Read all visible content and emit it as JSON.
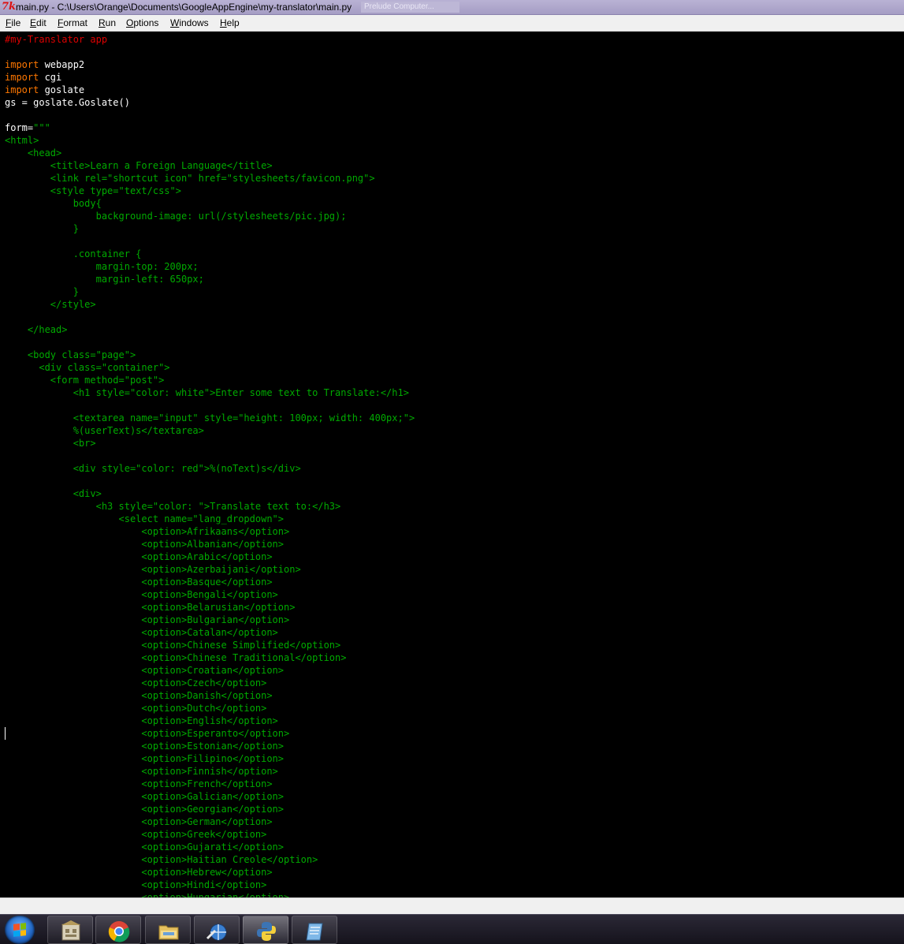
{
  "window": {
    "title": "main.py - C:\\Users\\Orange\\Documents\\GoogleAppEngine\\my-translator\\main.py",
    "background_window_title": "Prelude Computer...",
    "icon": "idle-icon"
  },
  "menu": [
    "File",
    "Edit",
    "Format",
    "Run",
    "Options",
    "Windows",
    "Help"
  ],
  "code_lines": [
    [
      {
        "t": "#my-Translator app",
        "c": "comment"
      }
    ],
    [],
    [
      {
        "t": "import",
        "c": "kw"
      },
      {
        "t": " webapp2",
        "c": "plain"
      }
    ],
    [
      {
        "t": "import",
        "c": "kw"
      },
      {
        "t": " cgi",
        "c": "plain"
      }
    ],
    [
      {
        "t": "import",
        "c": "kw"
      },
      {
        "t": " goslate",
        "c": "plain"
      }
    ],
    [
      {
        "t": "gs = goslate.Goslate()",
        "c": "plain"
      }
    ],
    [],
    [
      {
        "t": "form=",
        "c": "plain"
      },
      {
        "t": "\"\"\"",
        "c": "str"
      }
    ],
    [
      {
        "t": "<html>",
        "c": "str"
      }
    ],
    [
      {
        "t": "    <head>",
        "c": "str"
      }
    ],
    [
      {
        "t": "        <title>Learn a Foreign Language</title>",
        "c": "str"
      }
    ],
    [
      {
        "t": "        <link rel=\"shortcut icon\" href=\"stylesheets/favicon.png\">",
        "c": "str"
      }
    ],
    [
      {
        "t": "        <style type=\"text/css\">",
        "c": "str"
      }
    ],
    [
      {
        "t": "            body{",
        "c": "str"
      }
    ],
    [
      {
        "t": "                background-image: url(/stylesheets/pic.jpg);",
        "c": "str"
      }
    ],
    [
      {
        "t": "            }",
        "c": "str"
      }
    ],
    [],
    [
      {
        "t": "            .container {",
        "c": "str"
      }
    ],
    [
      {
        "t": "                margin-top: 200px;",
        "c": "str"
      }
    ],
    [
      {
        "t": "                margin-left: 650px;",
        "c": "str"
      }
    ],
    [
      {
        "t": "            }",
        "c": "str"
      }
    ],
    [
      {
        "t": "        </style>",
        "c": "str"
      }
    ],
    [],
    [
      {
        "t": "    </head>",
        "c": "str"
      }
    ],
    [],
    [
      {
        "t": "    <body class=\"page\">",
        "c": "str"
      }
    ],
    [
      {
        "t": "      <div class=\"container\">",
        "c": "str"
      }
    ],
    [
      {
        "t": "        <form method=\"post\">",
        "c": "str"
      }
    ],
    [
      {
        "t": "            <h1 style=\"color: white\">Enter some text to Translate:</h1>",
        "c": "str"
      }
    ],
    [],
    [
      {
        "t": "            <textarea name=\"input\" style=\"height: 100px; width: 400px;\">",
        "c": "str"
      }
    ],
    [
      {
        "t": "            %(userText)s</textarea>",
        "c": "str"
      }
    ],
    [
      {
        "t": "            <br>",
        "c": "str"
      }
    ],
    [],
    [
      {
        "t": "            <div style=\"color: red\">%(noText)s</div>",
        "c": "str"
      }
    ],
    [],
    [
      {
        "t": "            <div>",
        "c": "str"
      }
    ],
    [
      {
        "t": "                <h3 style=\"color: \">Translate text to:</h3>",
        "c": "str"
      }
    ],
    [
      {
        "t": "                    <select name=\"lang_dropdown\">",
        "c": "str"
      }
    ],
    [
      {
        "t": "                        <option>Afrikaans</option>",
        "c": "str"
      }
    ],
    [
      {
        "t": "                        <option>Albanian</option>",
        "c": "str"
      }
    ],
    [
      {
        "t": "                        <option>Arabic</option>",
        "c": "str"
      }
    ],
    [
      {
        "t": "                        <option>Azerbaijani</option>",
        "c": "str"
      }
    ],
    [
      {
        "t": "                        <option>Basque</option>",
        "c": "str"
      }
    ],
    [
      {
        "t": "                        <option>Bengali</option>",
        "c": "str"
      }
    ],
    [
      {
        "t": "                        <option>Belarusian</option>",
        "c": "str"
      }
    ],
    [
      {
        "t": "                        <option>Bulgarian</option>",
        "c": "str"
      }
    ],
    [
      {
        "t": "                        <option>Catalan</option>",
        "c": "str"
      }
    ],
    [
      {
        "t": "                        <option>Chinese Simplified</option>",
        "c": "str"
      }
    ],
    [
      {
        "t": "                        <option>Chinese Traditional</option>",
        "c": "str"
      }
    ],
    [
      {
        "t": "                        <option>Croatian</option>",
        "c": "str"
      }
    ],
    [
      {
        "t": "                        <option>Czech</option>",
        "c": "str"
      }
    ],
    [
      {
        "t": "                        <option>Danish</option>",
        "c": "str"
      }
    ],
    [
      {
        "t": "                        <option>Dutch</option>",
        "c": "str"
      }
    ],
    [
      {
        "t": "                        <option>English</option>",
        "c": "str"
      }
    ],
    [
      {
        "t": "                        <option>Esperanto</option>",
        "c": "str"
      }
    ],
    [
      {
        "t": "                        <option>Estonian</option>",
        "c": "str"
      }
    ],
    [
      {
        "t": "                        <option>Filipino</option>",
        "c": "str"
      }
    ],
    [
      {
        "t": "                        <option>Finnish</option>",
        "c": "str"
      }
    ],
    [
      {
        "t": "                        <option>French</option>",
        "c": "str"
      }
    ],
    [
      {
        "t": "                        <option>Galician</option>",
        "c": "str"
      }
    ],
    [
      {
        "t": "                        <option>Georgian</option>",
        "c": "str"
      }
    ],
    [
      {
        "t": "                        <option>German</option>",
        "c": "str"
      }
    ],
    [
      {
        "t": "                        <option>Greek</option>",
        "c": "str"
      }
    ],
    [
      {
        "t": "                        <option>Gujarati</option>",
        "c": "str"
      }
    ],
    [
      {
        "t": "                        <option>Haitian Creole</option>",
        "c": "str"
      }
    ],
    [
      {
        "t": "                        <option>Hebrew</option>",
        "c": "str"
      }
    ],
    [
      {
        "t": "                        <option>Hindi</option>",
        "c": "str"
      }
    ],
    [
      {
        "t": "                        <option>Hungarian</option>",
        "c": "str"
      }
    ]
  ],
  "colors": {
    "comment": "#dd0000",
    "keyword": "#ff7700",
    "string": "#00aa00",
    "plain": "#ffffff",
    "editor_bg": "#000000"
  },
  "taskbar": {
    "buttons": [
      {
        "icon": "start-orb-icon"
      },
      {
        "icon": "google-app-engine-launcher-icon"
      },
      {
        "icon": "chrome-icon"
      },
      {
        "icon": "file-explorer-icon"
      },
      {
        "icon": "network-tool-icon"
      },
      {
        "icon": "python-icon",
        "active": true
      },
      {
        "icon": "notepad-icon"
      }
    ]
  }
}
